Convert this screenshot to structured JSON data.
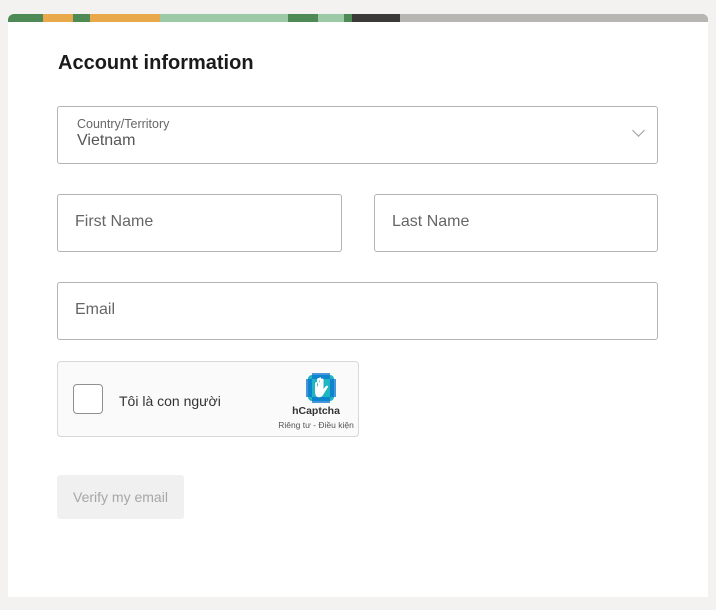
{
  "form": {
    "heading": "Account information",
    "country": {
      "label": "Country/Territory",
      "value": "Vietnam",
      "icon": "chevron-down-icon"
    },
    "first_name": {
      "placeholder": "First Name"
    },
    "last_name": {
      "placeholder": "Last Name"
    },
    "email": {
      "placeholder": "Email"
    },
    "captcha": {
      "label": "Tôi là con người",
      "brand": "hCaptcha",
      "links": "Riêng tư - Điều kiện",
      "icon": "hcaptcha-logo-icon"
    },
    "verify_button": "Verify my email"
  },
  "colors": {
    "banner_green": "#4e8a55",
    "banner_orange": "#e9a84a",
    "banner_mint": "#9cc9a6",
    "captcha_blue": "#0a74d0"
  }
}
